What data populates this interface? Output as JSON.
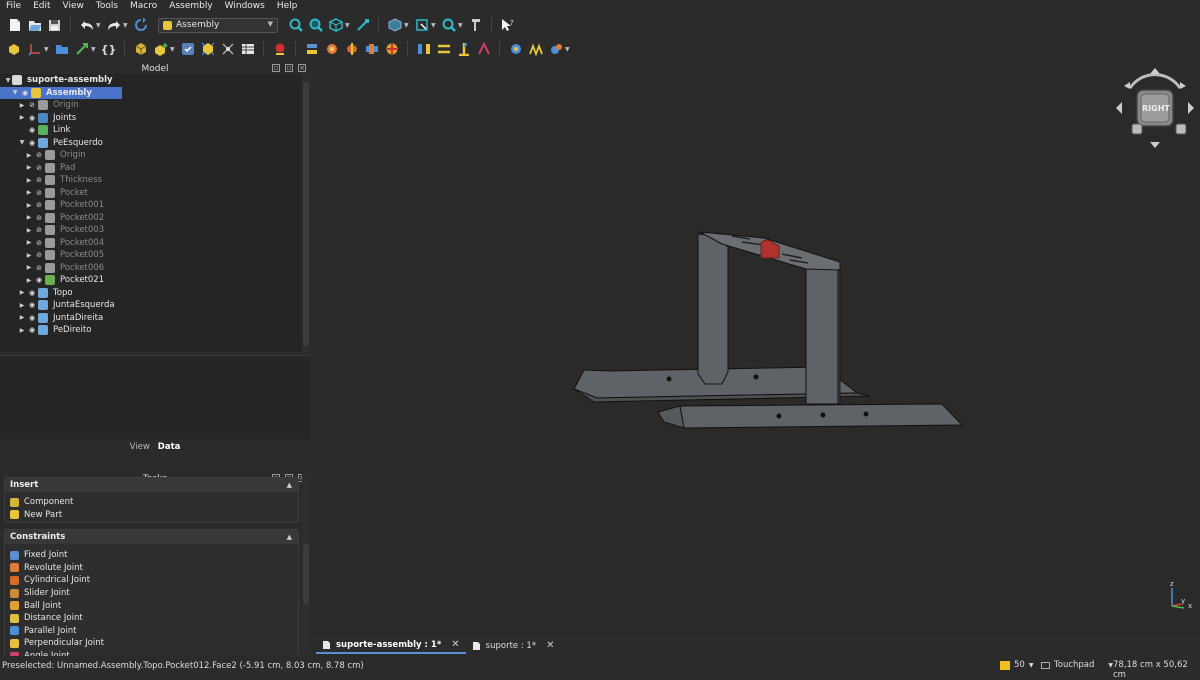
{
  "menu": [
    "File",
    "Edit",
    "View",
    "Tools",
    "Macro",
    "Assembly",
    "Windows",
    "Help"
  ],
  "workbench_selector": {
    "value": "Assembly"
  },
  "model_panel": {
    "title": "Model"
  },
  "tree": [
    {
      "label": "suporte-assembly",
      "depth": 0,
      "expand": "open",
      "icon": "document-icon",
      "color": "#d9d9d9",
      "bold": true,
      "dim": false,
      "eye": ""
    },
    {
      "label": "Assembly",
      "depth": 1,
      "expand": "open",
      "icon": "assembly-icon",
      "color": "#e8c63a",
      "bold": true,
      "dim": false,
      "eye": "visible",
      "selected": true
    },
    {
      "label": "Origin",
      "depth": 2,
      "expand": "closed",
      "icon": "origin-icon",
      "color": "#9a9a9a",
      "dim": true,
      "eye": "hidden"
    },
    {
      "label": "Joints",
      "depth": 2,
      "expand": "closed",
      "icon": "joints-icon",
      "color": "#4f88c6",
      "dim": false,
      "eye": "visible"
    },
    {
      "label": "Link",
      "depth": 2,
      "expand": "",
      "icon": "link-icon",
      "color": "#57b25b",
      "dim": false,
      "eye": "visible"
    },
    {
      "label": "PeEsquerdo",
      "depth": 2,
      "expand": "open",
      "icon": "body-icon",
      "color": "#6fa8dc",
      "dim": false,
      "eye": "visible"
    },
    {
      "label": "Origin",
      "depth": 3,
      "expand": "closed",
      "icon": "origin-icon",
      "color": "#9a9a9a",
      "dim": true,
      "eye": "hidden"
    },
    {
      "label": "Pad",
      "depth": 3,
      "expand": "closed",
      "icon": "pad-icon",
      "color": "#9a9a9a",
      "dim": true,
      "eye": "hidden"
    },
    {
      "label": "Thickness",
      "depth": 3,
      "expand": "closed",
      "icon": "thickness-icon",
      "color": "#9a9a9a",
      "dim": true,
      "eye": "hidden"
    },
    {
      "label": "Pocket",
      "depth": 3,
      "expand": "closed",
      "icon": "pocket-icon",
      "color": "#9a9a9a",
      "dim": true,
      "eye": "hidden"
    },
    {
      "label": "Pocket001",
      "depth": 3,
      "expand": "closed",
      "icon": "pocket-icon",
      "color": "#9a9a9a",
      "dim": true,
      "eye": "hidden"
    },
    {
      "label": "Pocket002",
      "depth": 3,
      "expand": "closed",
      "icon": "pocket-icon",
      "color": "#9a9a9a",
      "dim": true,
      "eye": "hidden"
    },
    {
      "label": "Pocket003",
      "depth": 3,
      "expand": "closed",
      "icon": "pocket-icon",
      "color": "#9a9a9a",
      "dim": true,
      "eye": "hidden"
    },
    {
      "label": "Pocket004",
      "depth": 3,
      "expand": "closed",
      "icon": "pocket-icon",
      "color": "#9a9a9a",
      "dim": true,
      "eye": "hidden"
    },
    {
      "label": "Pocket005",
      "depth": 3,
      "expand": "closed",
      "icon": "pocket-icon",
      "color": "#9a9a9a",
      "dim": true,
      "eye": "hidden"
    },
    {
      "label": "Pocket006",
      "depth": 3,
      "expand": "closed",
      "icon": "pocket-icon",
      "color": "#9a9a9a",
      "dim": true,
      "eye": "hidden"
    },
    {
      "label": "Pocket021",
      "depth": 3,
      "expand": "closed",
      "icon": "pocket-active-icon",
      "color": "#6ab04c",
      "dim": false,
      "eye": "visible"
    },
    {
      "label": "Topo",
      "depth": 2,
      "expand": "closed",
      "icon": "body-icon",
      "color": "#6fa8dc",
      "dim": false,
      "eye": "visible"
    },
    {
      "label": "JuntaEsquerda",
      "depth": 2,
      "expand": "closed",
      "icon": "body-icon",
      "color": "#6fa8dc",
      "dim": false,
      "eye": "visible"
    },
    {
      "label": "JuntaDireita",
      "depth": 2,
      "expand": "closed",
      "icon": "body-icon",
      "color": "#6fa8dc",
      "dim": false,
      "eye": "visible"
    },
    {
      "label": "PeDireito",
      "depth": 2,
      "expand": "closed",
      "icon": "body-icon",
      "color": "#6fa8dc",
      "dim": false,
      "eye": "visible"
    }
  ],
  "property_tabs": {
    "view": "View",
    "data": "Data"
  },
  "tasks_panel": {
    "title": "Tasks"
  },
  "insert_section": {
    "title": "Insert",
    "items": [
      {
        "label": "Component",
        "icon": "component-icon",
        "color": "#d6b43a"
      },
      {
        "label": "New Part",
        "icon": "new-part-icon",
        "color": "#e8c63a"
      }
    ]
  },
  "constraints_section": {
    "title": "Constraints",
    "items": [
      {
        "label": "Fixed Joint",
        "icon": "fixed-joint-icon",
        "color": "#5b8fd0"
      },
      {
        "label": "Revolute Joint",
        "icon": "revolute-joint-icon",
        "color": "#e07b39"
      },
      {
        "label": "Cylindrical Joint",
        "icon": "cylindrical-joint-icon",
        "color": "#d86a2a"
      },
      {
        "label": "Slider Joint",
        "icon": "slider-joint-icon",
        "color": "#c98b3a"
      },
      {
        "label": "Ball Joint",
        "icon": "ball-joint-icon",
        "color": "#e0a030"
      },
      {
        "label": "Distance Joint",
        "icon": "distance-joint-icon",
        "color": "#e0c040"
      },
      {
        "label": "Parallel Joint",
        "icon": "parallel-joint-icon",
        "color": "#4a90d9"
      },
      {
        "label": "Perpendicular Joint",
        "icon": "perpendicular-joint-icon",
        "color": "#e8c040"
      },
      {
        "label": "Angle Joint",
        "icon": "angle-joint-icon",
        "color": "#d04060"
      }
    ]
  },
  "navcube": {
    "face_label": "RIGHT"
  },
  "axis_labels": {
    "x": "x",
    "y": "y",
    "z": "z"
  },
  "doc_tabs": [
    {
      "label": "suporte-assembly : 1*",
      "active": true
    },
    {
      "label": "suporte : 1*",
      "active": false
    }
  ],
  "status": {
    "message": "Preselected: Unnamed.Assembly.Topo.Pocket012.Face2 (-5.91 cm, 8.03 cm, 8.78 cm)",
    "render_value": "50",
    "nav_style": "Touchpad",
    "dimensions": "78,18 cm x 50,62 cm"
  },
  "colors": {
    "selection": "#4a74c9",
    "model": "#5f6266",
    "highlight": "#b0332e",
    "background": "#2a2a2a"
  }
}
